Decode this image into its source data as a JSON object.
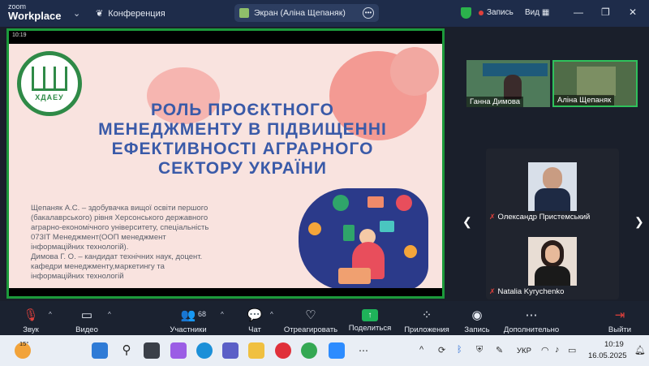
{
  "app": {
    "brand_small": "zoom",
    "brand": "Workplace"
  },
  "titlebar": {
    "meeting_label": "Конференция",
    "share_label": "Экран (Аліна Щепаняк)",
    "record_label": "Запись",
    "view_label": "Вид"
  },
  "slide": {
    "status_time": "10:19",
    "logo_text": "ХДАЕУ",
    "title_lines": [
      "РОЛЬ ПРОЄКТНОГО",
      "МЕНЕДЖМЕНТУ В ПІДВИЩЕННІ",
      "ЕФЕКТИВНОСТІ АГРАРНОГО",
      "СЕКТОРУ УКРАЇНИ"
    ],
    "body_lines": [
      "Щепаняк А.С. – здобувачка вищої освіти першого",
      "(бакалаврського) рівня Херсонського державного",
      "аграрно-економічного університету, спеціальність",
      "073ІТ Менеджмент(ООП менеджмент",
      "інформаційних технологій).",
      "Димова Г. О. – кандидат технічних наук, доцент.",
      "кафедри менеджменту,маркетингу та",
      "інформаційних технологій"
    ]
  },
  "participants": {
    "top": [
      {
        "name": "Ганна Димова"
      },
      {
        "name": "Аліна Щепаняк"
      }
    ],
    "gallery": [
      {
        "name": "Олександр Пристемський"
      },
      {
        "name": "Natalia Kyrychenko"
      }
    ]
  },
  "toolbar": {
    "mute": "Звук",
    "video": "Видео",
    "participants": "Участники",
    "participants_count": "68",
    "chat": "Чат",
    "react": "Отреагировать",
    "share": "Поделиться",
    "apps": "Приложения",
    "record": "Запись",
    "more": "Дополнительно",
    "leave": "Выйти"
  },
  "taskbar": {
    "weather_temp": "15°",
    "lang": "УКР",
    "time": "10:19",
    "date": "16.05.2025"
  },
  "colors": {
    "accent_green": "#1c9a3b",
    "title_blue": "#3a5aa8",
    "record_red": "#e0403b"
  }
}
